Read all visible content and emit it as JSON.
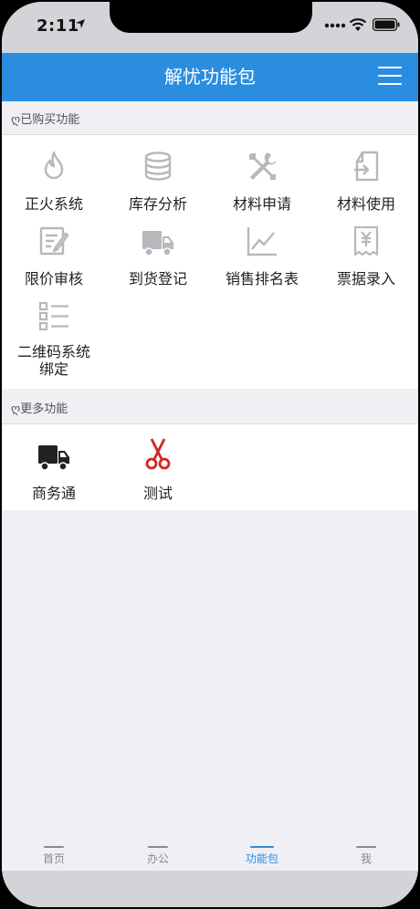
{
  "status_bar": {
    "time": "2:11"
  },
  "navbar": {
    "title": "解忧功能包",
    "menu_icon": "hamburger-menu-icon"
  },
  "purchased": {
    "header_symbol": "ღ",
    "header": "已购买功能",
    "items": [
      {
        "label": "正火系统",
        "icon": "flame-icon"
      },
      {
        "label": "库存分析",
        "icon": "database-icon"
      },
      {
        "label": "材料申请",
        "icon": "tools-icon"
      },
      {
        "label": "材料使用",
        "icon": "document-import-icon"
      },
      {
        "label": "限价审核",
        "icon": "edit-document-icon"
      },
      {
        "label": "到货登记",
        "icon": "truck-icon"
      },
      {
        "label": "销售排名表",
        "icon": "line-chart-icon"
      },
      {
        "label": "票据录入",
        "icon": "receipt-yen-icon"
      },
      {
        "label": "二维码系统绑定",
        "icon": "list-icon"
      }
    ]
  },
  "more": {
    "header_symbol": "ღ",
    "header": "更多功能",
    "items": [
      {
        "label": "商务通",
        "icon": "truck-icon"
      },
      {
        "label": "测试",
        "icon": "scissors-icon"
      }
    ]
  },
  "tabs": [
    {
      "label": "首页",
      "active": false
    },
    {
      "label": "办公",
      "active": false
    },
    {
      "label": "功能包",
      "active": true
    },
    {
      "label": "我",
      "active": false
    }
  ],
  "colors": {
    "accent": "#2b8de0",
    "icon_gray": "#b8b8bc",
    "icon_dark": "#222222",
    "scissors_red": "#d2261f"
  }
}
